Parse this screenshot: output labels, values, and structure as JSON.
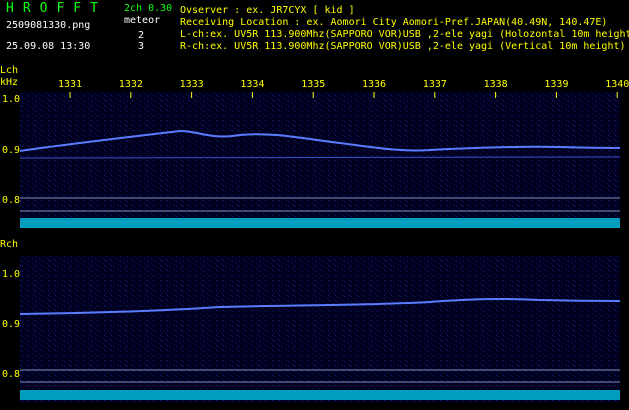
{
  "header": {
    "title": "HROFFT",
    "mode": "2ch 0.30",
    "meteor_label": "meteor",
    "lch_count": "2",
    "rch_count": "3",
    "filename": "2509081330.png",
    "timestamp": "25.09.08 13:30",
    "observer": "Ovserver           : ex. JR7CYX [ kid ]",
    "location": "Receiving Location : ex. Aomori City Aomori-Pref.JAPAN(40.49N, 140.47E)",
    "lch_info": "L-ch:ex. UV5R 113.900Mhz(SAPPORO VOR)USB ,2-ele yagi (Holozontal 10m height",
    "rch_info": "R-ch:ex. UV5R 113.900Mhz(SAPPORO VOR)USB ,2-ele yagi (Vertical 10m height)"
  },
  "time_ticks": [
    "1331",
    "1332",
    "1333",
    "1334",
    "1335",
    "1336",
    "1337",
    "1338",
    "1339",
    "1340"
  ],
  "lch": {
    "label": "Lch",
    "unit": "kHz",
    "axis": [
      "1.0",
      "0.9",
      "0.8"
    ]
  },
  "rch": {
    "label": "Rch",
    "axis": [
      "1.0",
      "0.9",
      "0.8"
    ]
  },
  "colors": {
    "text_yellow": "#ffff00",
    "title_green": "#10ff10",
    "trace": "#4a6cff",
    "noise_floor": "#00d8e8",
    "background": "#00001e"
  }
}
